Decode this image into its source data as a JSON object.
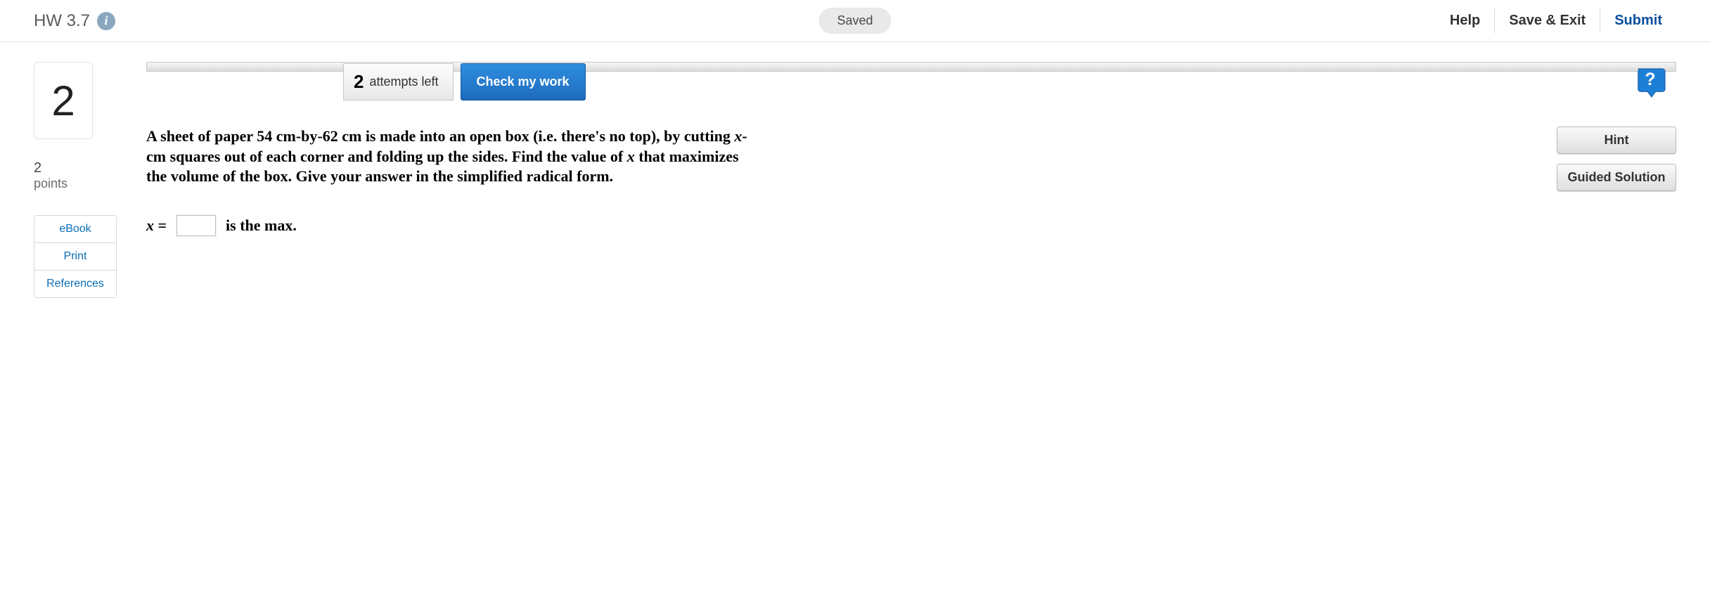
{
  "header": {
    "assignment_title": "HW 3.7",
    "info_icon_label": "i",
    "saved_status": "Saved",
    "help": "Help",
    "save_exit": "Save & Exit",
    "submit": "Submit"
  },
  "sidebar": {
    "question_number": "2",
    "points_value": "2",
    "points_label": "points",
    "links": {
      "ebook": "eBook",
      "print": "Print",
      "references": "References"
    }
  },
  "toolbar": {
    "attempts_count": "2",
    "attempts_label": "attempts left",
    "check_work": "Check my work"
  },
  "question": {
    "prompt_pre": "A sheet of paper 54 cm-by-62 cm is made into an open box (i.e. there's no top), by cutting ",
    "prompt_var1": "x",
    "prompt_mid": "-cm squares out of each corner and folding up the sides. Find the value of ",
    "prompt_var2": "x",
    "prompt_post": " that maximizes the volume of the box. Give your answer in the simplified radical form.",
    "answer_var": "x",
    "answer_equals": " = ",
    "answer_value": "",
    "answer_suffix": "is the max."
  },
  "aids": {
    "hint": "Hint",
    "guided": "Guided Solution"
  }
}
